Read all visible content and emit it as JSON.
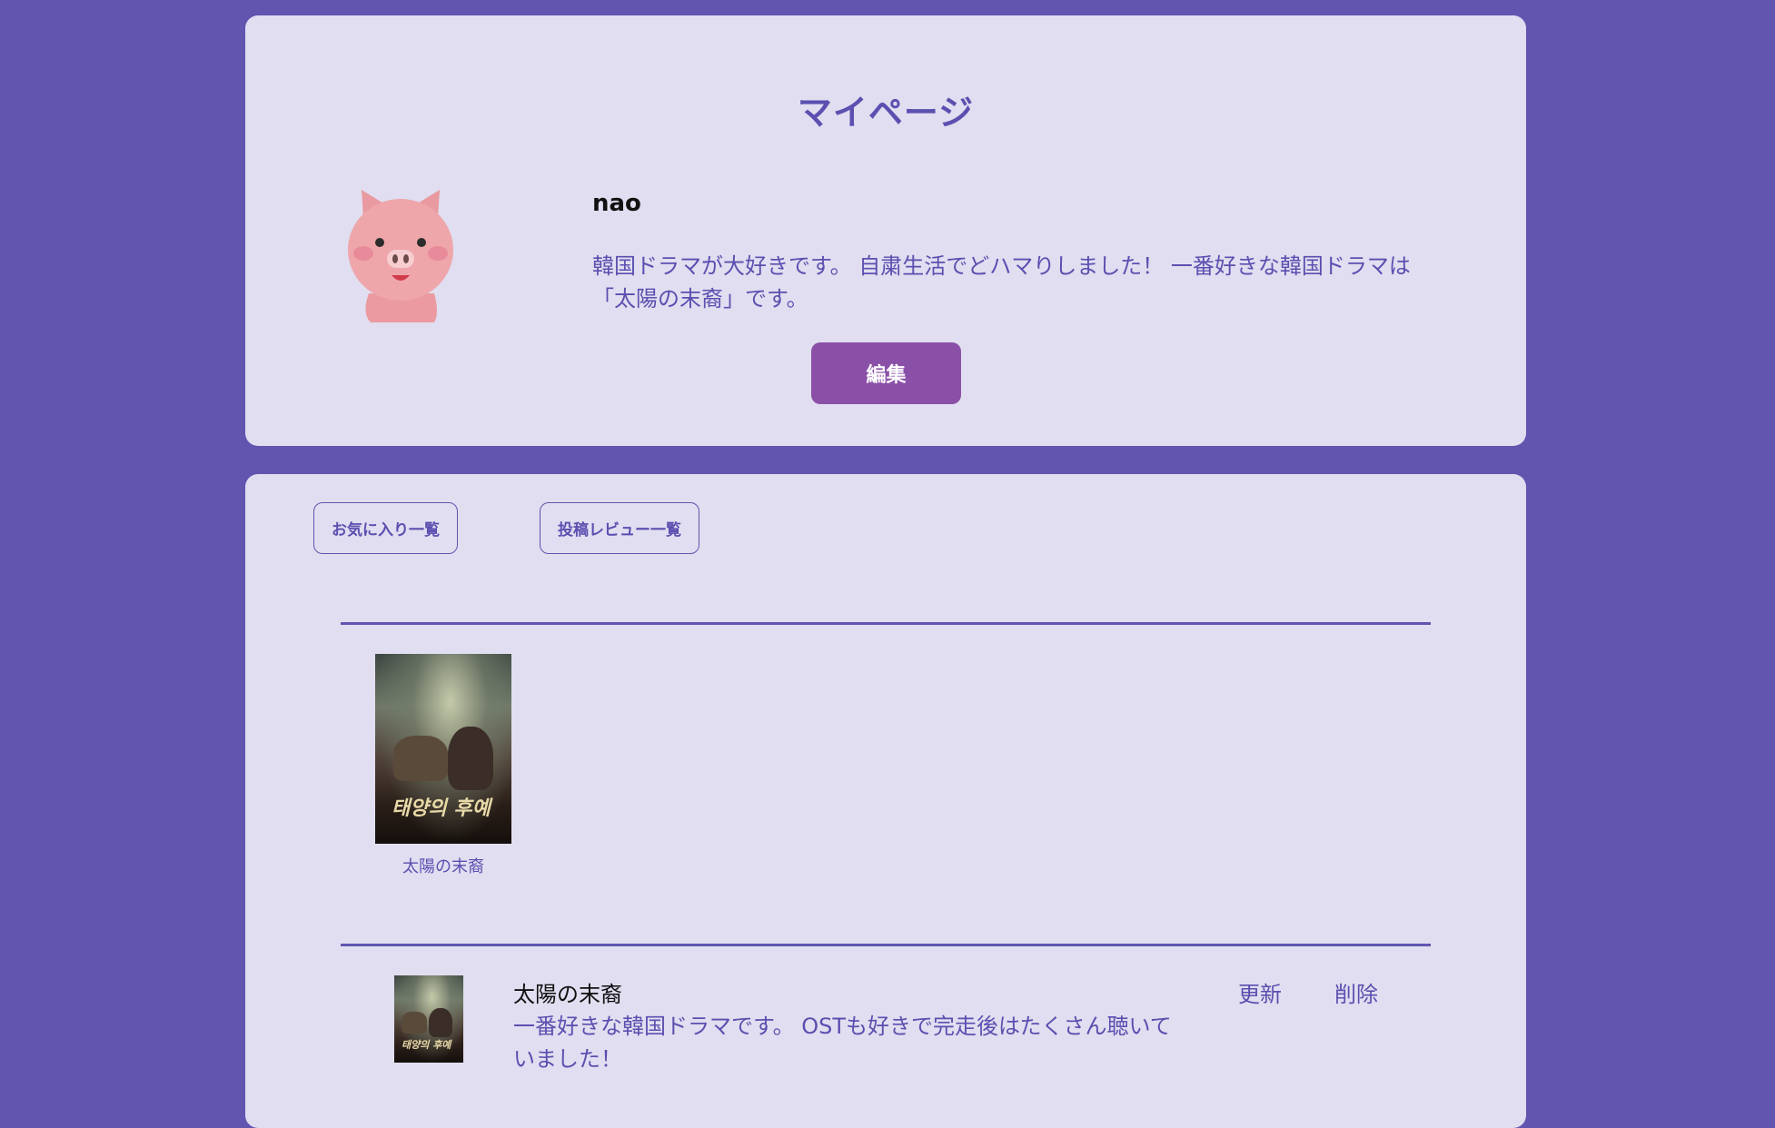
{
  "profile": {
    "page_title": "マイページ",
    "username": "nao",
    "bio": "韓国ドラマが大好きです。 自粛生活でどハマりしました！ 一番好きな韓国ドラマは「太陽の末裔」です。",
    "edit_label": "編集"
  },
  "tabs": {
    "favorites_label": "お気に入り一覧",
    "reviews_label": "投稿レビュー一覧"
  },
  "favorites": [
    {
      "title": "太陽の末裔",
      "poster_logo": "태양의 후예"
    }
  ],
  "reviews": [
    {
      "title": "太陽の末裔",
      "body": "一番好きな韓国ドラマです。 OSTも好きで完走後はたくさん聴いていました！",
      "update_label": "更新",
      "delete_label": "削除",
      "poster_logo": "태양의 후예"
    }
  ],
  "colors": {
    "background": "#6155b0",
    "card": "#e0def0",
    "accent_text": "#5b4fb0",
    "edit_button": "#8a50a8"
  },
  "icons": {
    "avatar": "pig-avatar-icon"
  }
}
